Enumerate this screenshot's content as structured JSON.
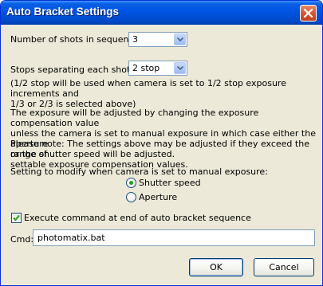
{
  "window": {
    "title": "Auto Bracket Settings"
  },
  "shots": {
    "label": "Number of shots in sequence:",
    "value": "3"
  },
  "stops": {
    "label": "Stops separating each shot:",
    "value": "2 stop",
    "note": "(1/2 stop will be used when camera is set to 1/2 stop exposure increments and\n1/3 or 2/3 is selected above)"
  },
  "info": {
    "paragraph1": "The exposure will be adjusted by changing the exposure compensation value\nunless the camera is set to manual exposure in which case either the aperture\nor the shutter speed will be adjusted.",
    "paragraph2": "Please note: The settings above may be adjusted if they exceed the range of\nsettable exposure compensation values."
  },
  "manual": {
    "label": "Setting to modify when camera is set to manual exposure:",
    "options": [
      {
        "label": "Shutter speed",
        "selected": true
      },
      {
        "label": "Aperture",
        "selected": false
      }
    ]
  },
  "execute": {
    "label": "Execute command at end of auto bracket sequence",
    "checked": true
  },
  "cmd": {
    "label": "Cmd:",
    "value": "photomatix.bat"
  },
  "buttons": {
    "ok": "OK",
    "cancel": "Cancel"
  },
  "colors": {
    "titlebar": "#0054e3",
    "dialog_bg": "#ece9d8",
    "close_button": "#d6512c",
    "radio_dot": "#21a121",
    "check_mark": "#21a121"
  }
}
